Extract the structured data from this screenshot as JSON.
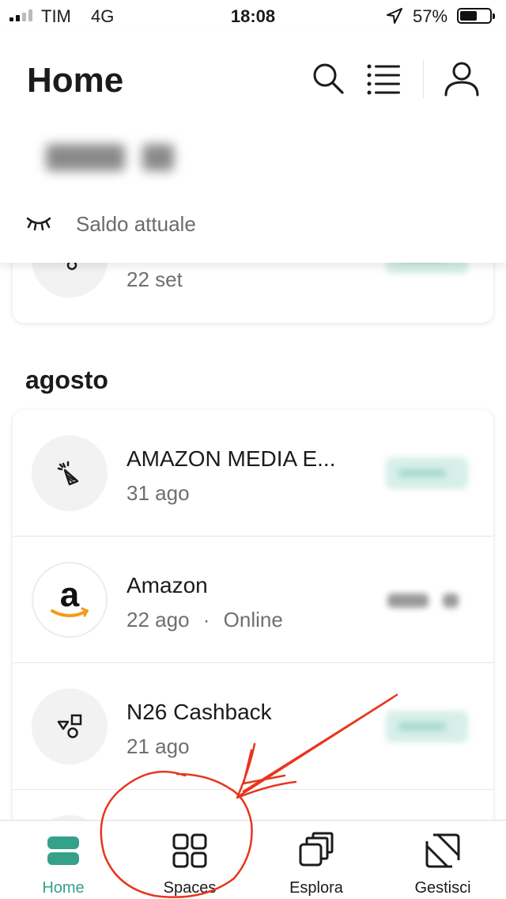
{
  "status_bar": {
    "carrier": "TIM",
    "network": "4G",
    "time": "18:08",
    "battery": "57%"
  },
  "header": {
    "title": "Home",
    "balance_label": "Saldo attuale",
    "icons": [
      "search-icon",
      "list-icon",
      "user-icon",
      "eye-closed-icon"
    ]
  },
  "transactions": {
    "previous": {
      "subtitle": "22 set",
      "icon": "shapes-icon"
    },
    "section_title": "agosto",
    "items": [
      {
        "title": "AMAZON MEDIA E...",
        "subtitle": "31 ago",
        "icon": "party-icon"
      },
      {
        "title": "Amazon",
        "date": "22 ago",
        "separator": "·",
        "channel": "Online",
        "icon": "amazon-logo"
      },
      {
        "title": "N26 Cashback",
        "subtitle": "21 ago",
        "icon": "shapes-icon"
      }
    ]
  },
  "tab_bar": {
    "tabs": [
      {
        "label": "Home",
        "active": true
      },
      {
        "label": "Spaces",
        "active": false
      },
      {
        "label": "Esplora",
        "active": false
      },
      {
        "label": "Gestisci",
        "active": false
      }
    ]
  },
  "colors": {
    "accent": "#36a18b",
    "annotation": "#e8351d"
  }
}
